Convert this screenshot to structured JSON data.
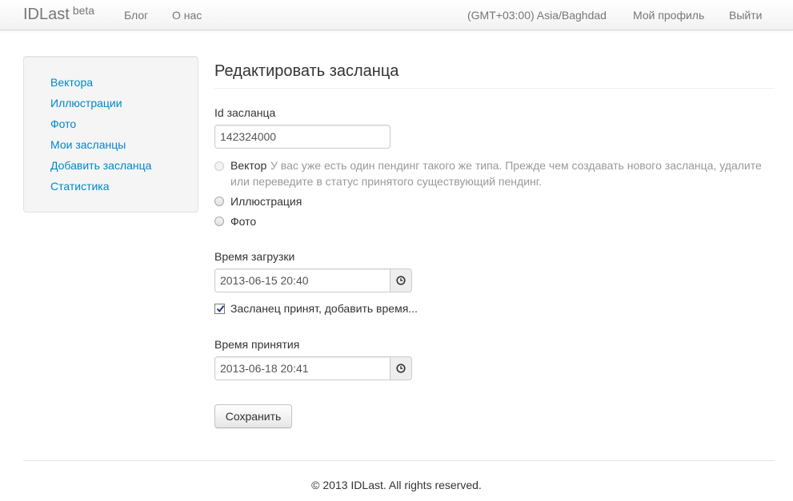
{
  "navbar": {
    "brand": "IDLast",
    "brand_badge": "beta",
    "links": [
      "Блог",
      "О нас"
    ],
    "timezone": "(GMT+03:00) Asia/Baghdad",
    "profile": "Мой профиль",
    "logout": "Выйти"
  },
  "sidebar": {
    "items": [
      "Вектора",
      "Иллюстрации",
      "Фото",
      "Мои засланцы",
      "Добавить засланца",
      "Статистика"
    ]
  },
  "form": {
    "title": "Редактировать засланца",
    "id_label": "Id засланца",
    "id_value": "142324000",
    "type_options": [
      {
        "label": "Вектор",
        "disabled": true,
        "selected": false
      },
      {
        "label": "Иллюстрация",
        "disabled": false,
        "selected": false
      },
      {
        "label": "Фото",
        "disabled": false,
        "selected": false
      }
    ],
    "vector_help": "У вас уже есть один пендинг такого же типа. Прежде чем создавать нового засланца, удалите",
    "vector_help_line2": "или переведите в статус принятого существующий пендинг.",
    "upload_label": "Время загрузки",
    "upload_value": "2013-06-15 20:40",
    "accepted_checkbox_label": "Засланец принят, добавить время...",
    "accepted_checked": true,
    "accept_label": "Время принятия",
    "accept_value": "2013-06-18 20:41",
    "save": "Сохранить"
  },
  "footer": {
    "text": "© 2013 IDLast. All rights reserved."
  },
  "colors": {
    "link": "#0088cc",
    "muted": "#999999",
    "nav_text": "#777777"
  }
}
